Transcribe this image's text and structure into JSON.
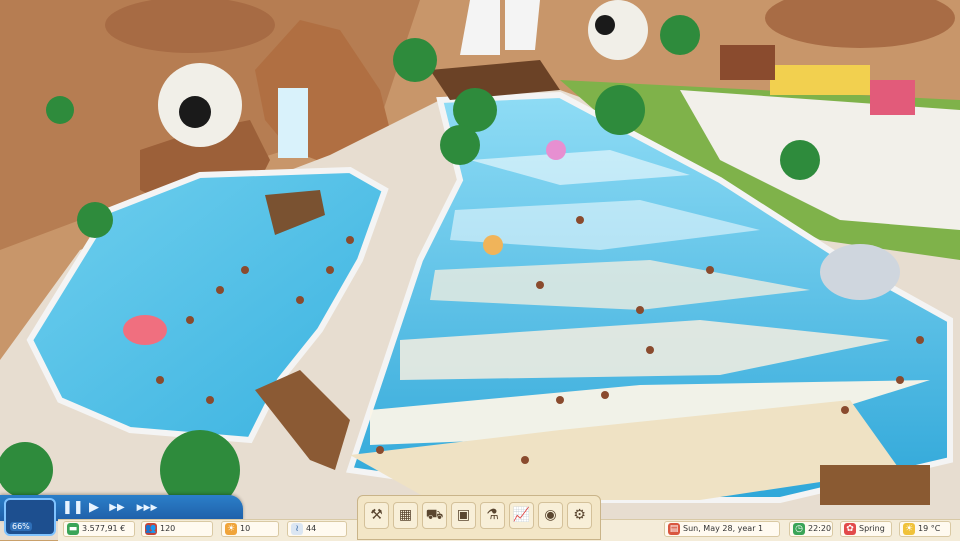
{
  "hud": {
    "park_rating": "66%",
    "speed_controls": [
      {
        "name": "pause",
        "glyph": "❚❚"
      },
      {
        "name": "play",
        "glyph": "▶"
      },
      {
        "name": "fast",
        "glyph": "▶▶"
      },
      {
        "name": "fastest",
        "glyph": "▶▶▶"
      }
    ],
    "money": "3.577,91 €",
    "guests": "120",
    "staff": "10",
    "wave_count": "44",
    "toolbar": [
      {
        "name": "build",
        "glyph": "⚒"
      },
      {
        "name": "terrain",
        "glyph": "▦"
      },
      {
        "name": "bulldozer",
        "glyph": "⛟"
      },
      {
        "name": "management",
        "glyph": "▣"
      },
      {
        "name": "research",
        "glyph": "⚗"
      },
      {
        "name": "finances",
        "glyph": "📈"
      },
      {
        "name": "view",
        "glyph": "◉"
      },
      {
        "name": "settings",
        "glyph": "⚙"
      }
    ],
    "date": "Sun, May 28, year 1",
    "time": "22:20",
    "season": "Spring",
    "temperature": "19 °C"
  },
  "colors": {
    "water": "#4fc3e6",
    "sand": "#efe2c4",
    "rock": "#b87a4b",
    "ui_blue": "#2b7fc9",
    "ui_cream": "#f4ecd9"
  }
}
